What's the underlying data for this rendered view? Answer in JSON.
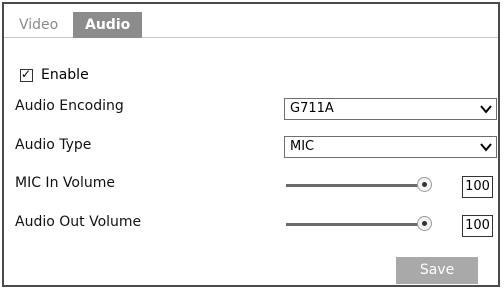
{
  "tabs": [
    {
      "label": "Video",
      "active": false
    },
    {
      "label": "Audio",
      "active": true
    }
  ],
  "enable": {
    "label": "Enable",
    "checked": true
  },
  "fields": {
    "audio_encoding": {
      "label": "Audio Encoding",
      "value": "G711A"
    },
    "audio_type": {
      "label": "Audio Type",
      "value": "MIC"
    },
    "mic_in_volume": {
      "label": "MIC In Volume",
      "value": "100"
    },
    "audio_out_volume": {
      "label": "Audio Out Volume",
      "value": "100"
    }
  },
  "save_label": "Save",
  "colors": {
    "active_tab_bg": "#8c8c8c",
    "save_button_bg": "#a9a9a9",
    "border": "#4a4a4a"
  }
}
